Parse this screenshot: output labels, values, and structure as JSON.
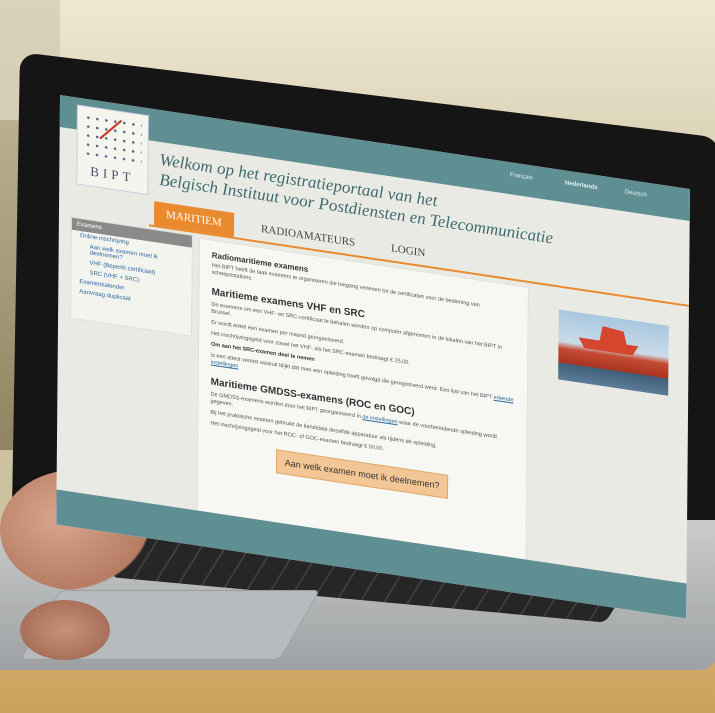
{
  "site": {
    "languages": [
      "Français",
      "Nederlands",
      "Deutsch"
    ],
    "logo_text": "BIPT",
    "title_line1": "Welkom op het registratieportaal van het",
    "title_line2": "Belgisch Instituut voor Postdiensten en Telecommunicatie"
  },
  "nav": {
    "tabs": [
      "MARITIEM",
      "RADIOAMATEURS",
      "LOGIN"
    ]
  },
  "sidebar": {
    "header": "Examens",
    "items": [
      {
        "label": "Online-inschrijving",
        "sub": false
      },
      {
        "label": "Aan welk examen moet ik deelnemen?",
        "sub": true
      },
      {
        "label": "VHF (Beperkt certificaat)",
        "sub": true
      },
      {
        "label": "SRC (VHF + SRC)",
        "sub": true
      },
      {
        "label": "Examenkalender",
        "sub": false
      },
      {
        "label": "Aanvraag duplicaat",
        "sub": false
      }
    ]
  },
  "content": {
    "heading": "Radiomaritieme examens",
    "intro": "Het BIPT heeft de taak examens te organiseren die toegang verlenen tot de certificaten voor de bediening van scheepsstations.",
    "sec1_title": "Maritieme examens VHF en SRC",
    "sec1_p1": "De examens om een VHF- en SRC-certificaat te behalen worden op computer afgenomen in de lokalen van het BIPT in Brussel.",
    "sec1_p2": "Er wordt enkel een examen per maand georganiseerd.",
    "sec1_p3": "Het inschrijvingsgeld voor zowel het VHF- als het SRC-examen bedraagt € 25,00.",
    "sec1_p4": "Om aan het SRC-examen deel te nemen",
    "sec1_p5": "is een attest vereist waaruit blijkt dat men een opleiding heeft gevolgd die geregistreerd werd. Een lijst van het BIPT",
    "sec1_link": "erkende instellingen",
    "sec2_title": "Maritieme GMDSS-examens (ROC en GOC)",
    "sec2_p1": "De GMDSS-examens worden door het BIPT georganiseerd in",
    "sec2_link": "de instellingen",
    "sec2_p1b": "waar de voorbereidende opleiding wordt gegeven.",
    "sec2_p2": "Bij het praktische examen gebruikt de kandidaat dezelfde apparatuur als tijdens de opleiding.",
    "sec2_p3": "Het inschrijvingsgeld voor het ROC- of GOC-examen bedraagt € 50,00.",
    "cta": "Aan welk examen moet ik deelnemen?"
  },
  "colors": {
    "teal": "#5f8e93",
    "orange": "#e98a2f",
    "button": "#f3c696"
  }
}
